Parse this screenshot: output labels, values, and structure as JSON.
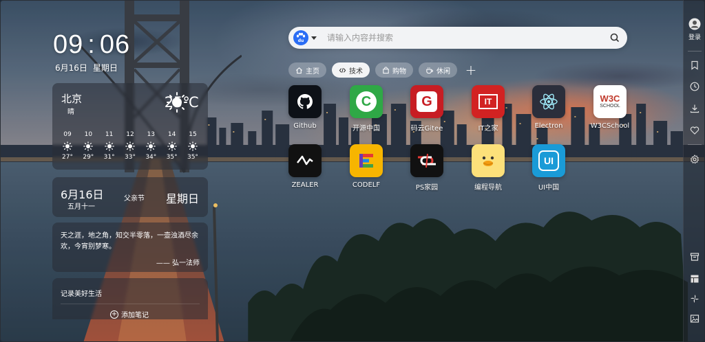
{
  "clock": {
    "hours": "09",
    "separator": ":",
    "minutes": "06"
  },
  "date": {
    "day": "6月16日",
    "weekday": "星期日"
  },
  "weather": {
    "city": "北京",
    "condition": "晴",
    "temperature": "25℃",
    "hourly": [
      {
        "hour": "09",
        "temp": "27°"
      },
      {
        "hour": "10",
        "temp": "29°"
      },
      {
        "hour": "11",
        "temp": "31°"
      },
      {
        "hour": "12",
        "temp": "33°"
      },
      {
        "hour": "13",
        "temp": "34°"
      },
      {
        "hour": "14",
        "temp": "35°"
      },
      {
        "hour": "15",
        "temp": "35°"
      }
    ],
    "icon": "sun-icon"
  },
  "calendar": {
    "date": "6月16日",
    "lunar": "五月十一",
    "festival": "父亲节",
    "weekday": "星期日"
  },
  "quote": {
    "text": "天之涯，地之角，知交半零落，一壶浊酒尽余欢，今宵别梦寒。",
    "author": "—— 弘一法师"
  },
  "memo": {
    "title": "记录美好生活",
    "add_label": "添加笔记"
  },
  "search": {
    "placeholder": "请输入内容并搜索",
    "engine": "baidu",
    "engine_label": "du"
  },
  "tabs": [
    {
      "label": "主页",
      "icon": "home-icon",
      "active": false
    },
    {
      "label": "技术",
      "icon": "code-icon",
      "active": true
    },
    {
      "label": "购物",
      "icon": "bag-icon",
      "active": false
    },
    {
      "label": "休闲",
      "icon": "coffee-icon",
      "active": false
    }
  ],
  "apps": [
    {
      "label": "Github",
      "icon": "github-icon",
      "bg": "#0d1117"
    },
    {
      "label": "开源中国",
      "icon": "oschina-icon",
      "bg": "#2fa846",
      "glyph": "C"
    },
    {
      "label": "码云Gitee",
      "icon": "gitee-icon",
      "bg": "#c71d23",
      "glyph": "G"
    },
    {
      "label": "IT之家",
      "icon": "ithome-icon",
      "bg": "#d22222",
      "glyph": "IT"
    },
    {
      "label": "Electron",
      "icon": "electron-icon",
      "bg": "#2b2e3b"
    },
    {
      "label": "W3CSchool",
      "icon": "w3cschool-icon",
      "bg": "#ffffff",
      "glyph": "W3C",
      "glyph_sub": "SCHOOL"
    },
    {
      "label": "ZEALER",
      "icon": "zealer-icon",
      "bg": "#111111"
    },
    {
      "label": "CODELF",
      "icon": "codelf-icon",
      "bg": "#f7b500"
    },
    {
      "label": "PS家园",
      "icon": "ps-icon",
      "bg": "#111111"
    },
    {
      "label": "编程导航",
      "icon": "duck-icon",
      "bg": "#fce07a"
    },
    {
      "label": "UI中国",
      "icon": "uichina-icon",
      "bg": "#1a9bd7",
      "glyph": "UI"
    }
  ],
  "sidebar": {
    "login_label": "登录",
    "items": [
      "bookmark-icon",
      "history-icon",
      "download-icon",
      "heart-icon",
      "settings-icon",
      "archive-icon",
      "layout-icon",
      "pinwheel-icon",
      "image-icon"
    ]
  },
  "colors": {
    "accent": "#2a6df5",
    "card_bg": "rgba(40,44,52,0.55)"
  }
}
